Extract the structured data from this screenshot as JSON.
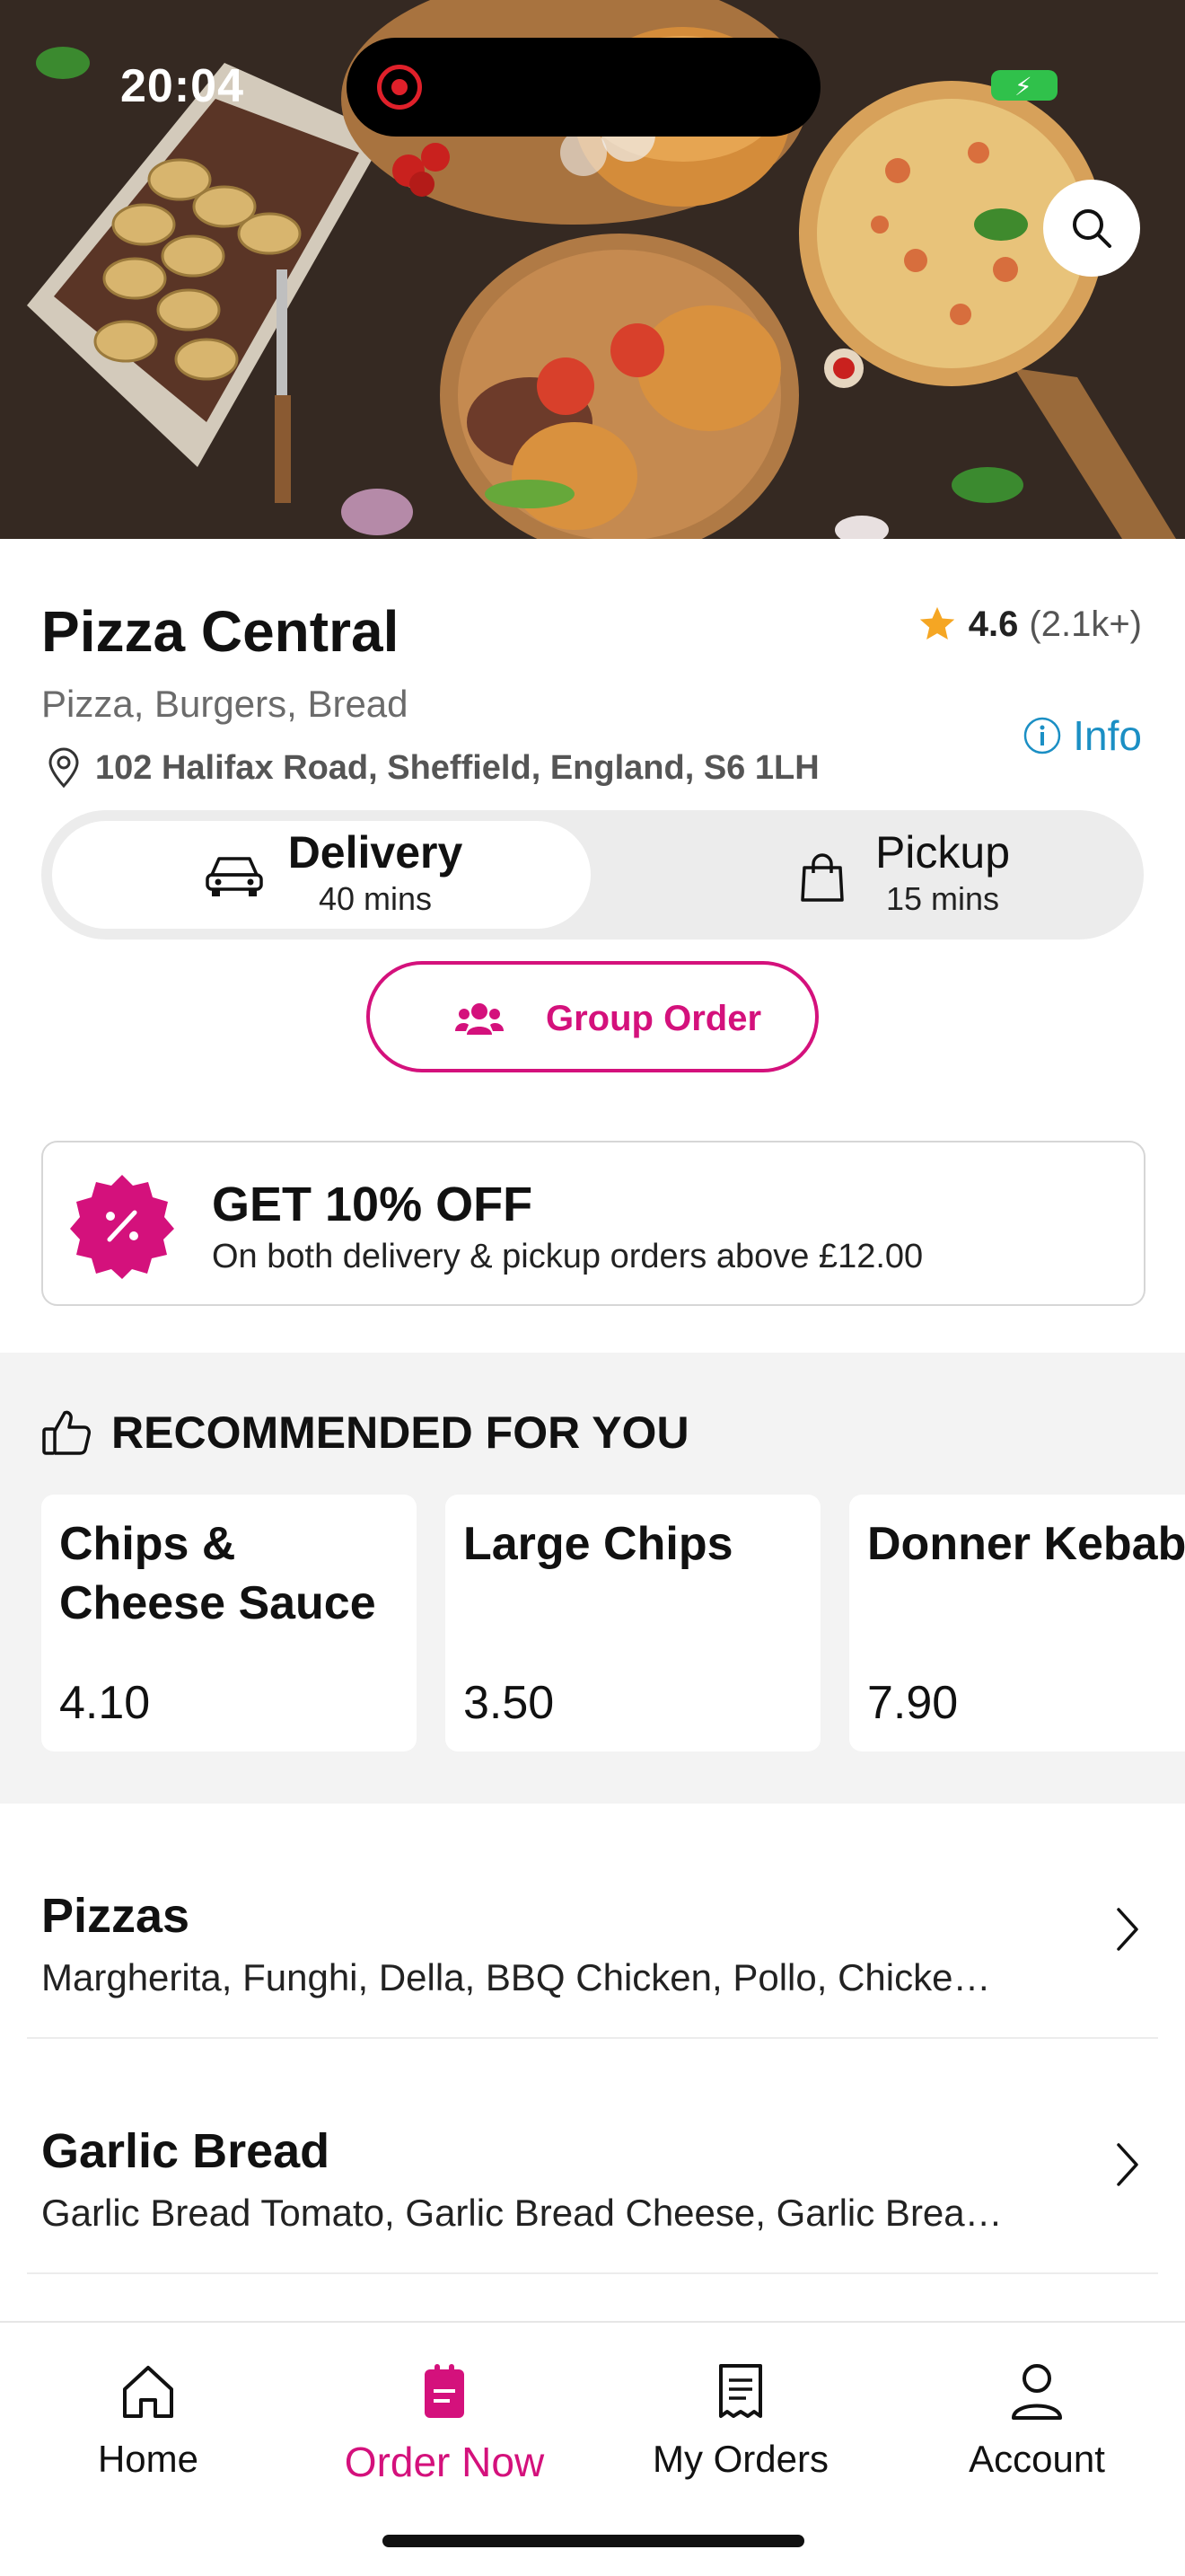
{
  "status_bar": {
    "time": "20:04"
  },
  "restaurant": {
    "name": "Pizza Central",
    "rating": "4.6",
    "rating_count": "(2.1k+)",
    "cuisines": "Pizza, Burgers, Bread",
    "address": "102 Halifax Road, Sheffield, England, S6 1LH",
    "info_label": "Info"
  },
  "modes": {
    "delivery": {
      "label": "Delivery",
      "time": "40 mins",
      "selected": true
    },
    "pickup": {
      "label": "Pickup",
      "time": "15 mins",
      "selected": false
    }
  },
  "group_order": {
    "label": "Group Order"
  },
  "offer": {
    "title": "GET 10% OFF",
    "description": "On both delivery & pickup orders above £12.00"
  },
  "recommended": {
    "title": "RECOMMENDED FOR YOU",
    "items": [
      {
        "name": "Chips & Cheese Sauce",
        "price": "4.10"
      },
      {
        "name": "Large Chips",
        "price": "3.50"
      },
      {
        "name": "Donner Kebab",
        "price": "7.90"
      }
    ]
  },
  "categories": [
    {
      "name": "Pizzas",
      "items": "Margherita, Funghi, Della, BBQ Chicken, Pollo, Chicke…"
    },
    {
      "name": "Garlic Bread",
      "items": "Garlic Bread Tomato, Garlic Bread Cheese, Garlic Brea…"
    }
  ],
  "tabs": [
    {
      "label": "Home",
      "icon": "home-icon",
      "active": false
    },
    {
      "label": "Order Now",
      "icon": "order-icon",
      "active": true
    },
    {
      "label": "My Orders",
      "icon": "receipt-icon",
      "active": false
    },
    {
      "label": "Account",
      "icon": "user-icon",
      "active": false
    }
  ],
  "colors": {
    "accent": "#d4117c",
    "info_link": "#1b8fc4",
    "star": "#f5a623",
    "battery": "#30c14b"
  }
}
